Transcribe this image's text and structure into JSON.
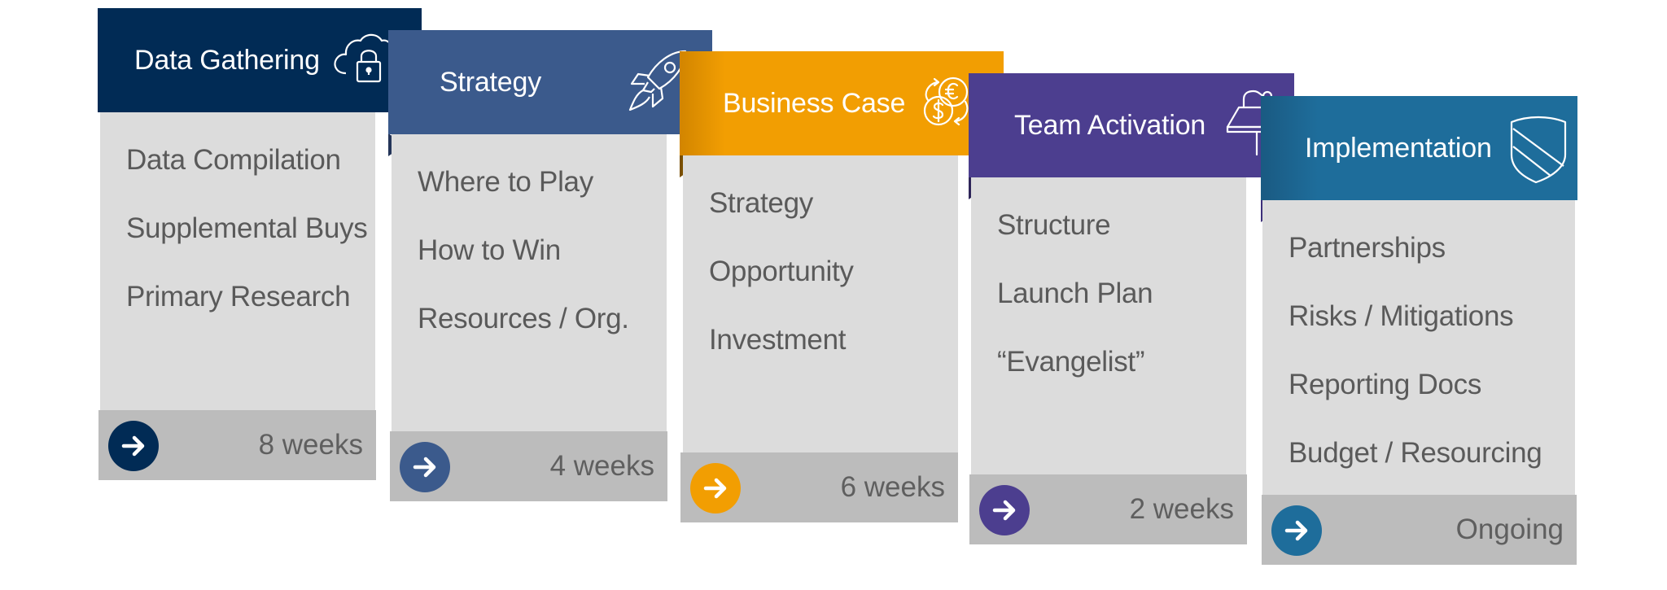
{
  "diagram": {
    "type": "process-steps",
    "steps": [
      {
        "title": "Data Gathering",
        "icon": "cloud-lock-icon",
        "color": "#012b55",
        "fold_color": "#001a33",
        "items": [
          "Data Compilation",
          "Supplemental Buys",
          "Primary Research"
        ],
        "duration": "8 weeks"
      },
      {
        "title": "Strategy",
        "icon": "rocket-icon",
        "color": "#3b5a8c",
        "fold_color": "#243559",
        "items": [
          "Where to Play",
          "How to Win",
          "Resources / Org."
        ],
        "duration": "4 weeks"
      },
      {
        "title": "Business Case",
        "icon": "currency-exchange-icon",
        "color": "#f29e02",
        "fold_color": "#7a4f00",
        "items": [
          "Strategy",
          "Opportunity",
          "Investment"
        ],
        "duration": "6 weeks"
      },
      {
        "title": "Team Activation",
        "icon": "podium-microphone-icon",
        "color": "#4c3e8f",
        "fold_color": "#2e2559",
        "items": [
          "Structure",
          "Launch Plan",
          "“Evangelist”"
        ],
        "duration": "2 weeks"
      },
      {
        "title": "Implementation",
        "icon": "shield-icon",
        "color": "#1e6d9b",
        "fold_color": "#14486a",
        "items": [
          "Partnerships",
          "Risks / Mitigations",
          "Reporting Docs",
          "Budget / Resourcing"
        ],
        "duration": "Ongoing"
      }
    ]
  }
}
